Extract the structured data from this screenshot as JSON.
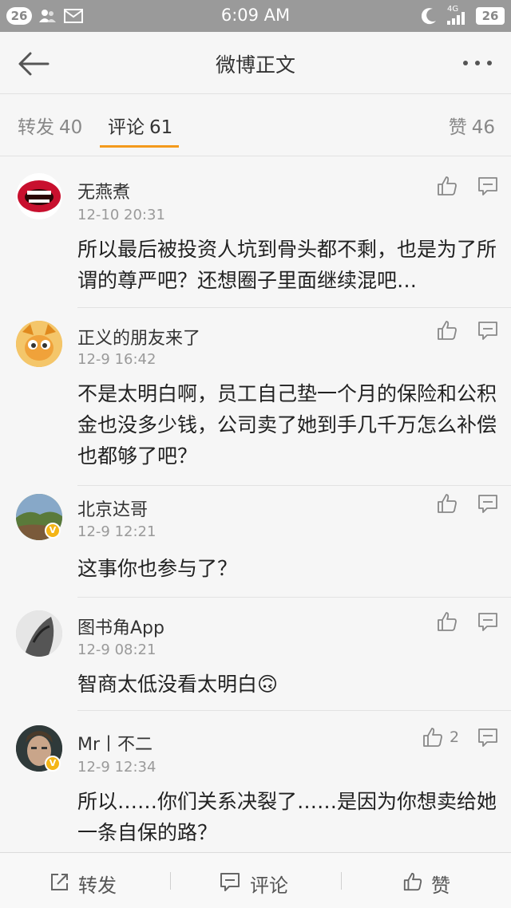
{
  "status_bar": {
    "notif_count_left": "26",
    "time": "6:09 AM",
    "network": "4G",
    "battery": "26"
  },
  "nav": {
    "title": "微博正文"
  },
  "tabs": [
    {
      "label": "转发",
      "count": "40"
    },
    {
      "label": "评论",
      "count": "61"
    },
    {
      "label": "赞",
      "count": "46"
    }
  ],
  "comments": [
    {
      "name": "无燕煮",
      "time": "12-10 20:31",
      "text": "所以最后被投资人坑到骨头都不剩，也是为了所谓的尊严吧？还想圈子里面继续混吧…",
      "likes": "",
      "verified": false
    },
    {
      "name": "正义的朋友来了",
      "time": "12-9 16:42",
      "text": "不是太明白啊，员工自己垫一个月的保险和公积金也没多少钱，公司卖了她到手几千万怎么补偿也都够了吧？",
      "likes": "",
      "verified": false
    },
    {
      "name": "北京达哥",
      "time": "12-9 12:21",
      "text": "这事你也参与了？",
      "likes": "",
      "verified": true
    },
    {
      "name": "图书角App",
      "time": "12-9 08:21",
      "text": "智商太低没看太明白🙃",
      "likes": "",
      "verified": false
    },
    {
      "name": "Mr丨不二",
      "time": "12-9 12:34",
      "text": "所以……你们关系决裂了……是因为你想卖给她一条自保的路？",
      "likes": "2",
      "verified": true
    }
  ],
  "bottom_bar": {
    "repost_label": "转发",
    "comment_label": "评论",
    "like_label": "赞"
  },
  "colors": {
    "accent": "#f49a1c",
    "status_bar_bg": "#9a9a9a",
    "verified": "#f4b516"
  }
}
